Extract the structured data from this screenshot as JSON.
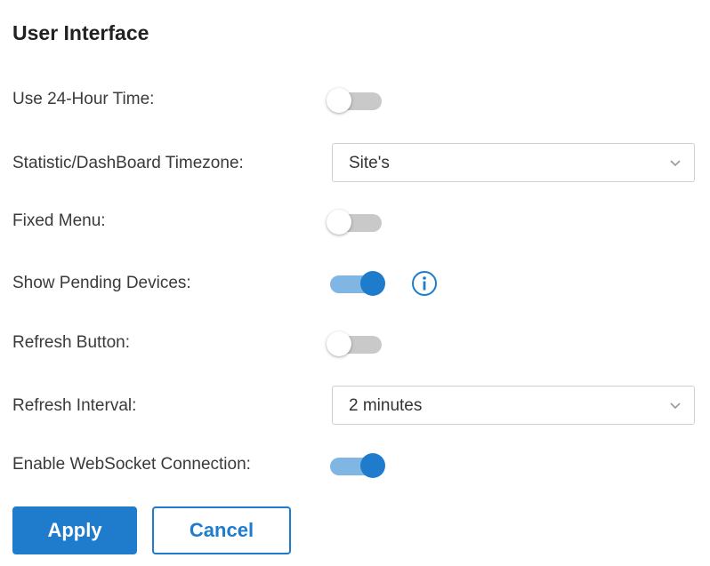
{
  "panel": {
    "title": "User Interface"
  },
  "settings": {
    "use_24_hour_time": {
      "label": "Use 24-Hour Time:",
      "enabled": false
    },
    "timezone": {
      "label": "Statistic/DashBoard Timezone:",
      "value": "Site's"
    },
    "fixed_menu": {
      "label": "Fixed Menu:",
      "enabled": false
    },
    "show_pending_devices": {
      "label": "Show Pending Devices:",
      "enabled": true,
      "info_icon": "info-circle-icon"
    },
    "refresh_button": {
      "label": "Refresh Button:",
      "enabled": false
    },
    "refresh_interval": {
      "label": "Refresh Interval:",
      "value": "2 minutes"
    },
    "enable_websocket": {
      "label": "Enable WebSocket Connection:",
      "enabled": true
    }
  },
  "actions": {
    "apply_label": "Apply",
    "cancel_label": "Cancel"
  },
  "colors": {
    "accent": "#1f7ccc",
    "toggle_on_track": "#7fb6e3",
    "toggle_off_track": "#c9c9c9"
  }
}
